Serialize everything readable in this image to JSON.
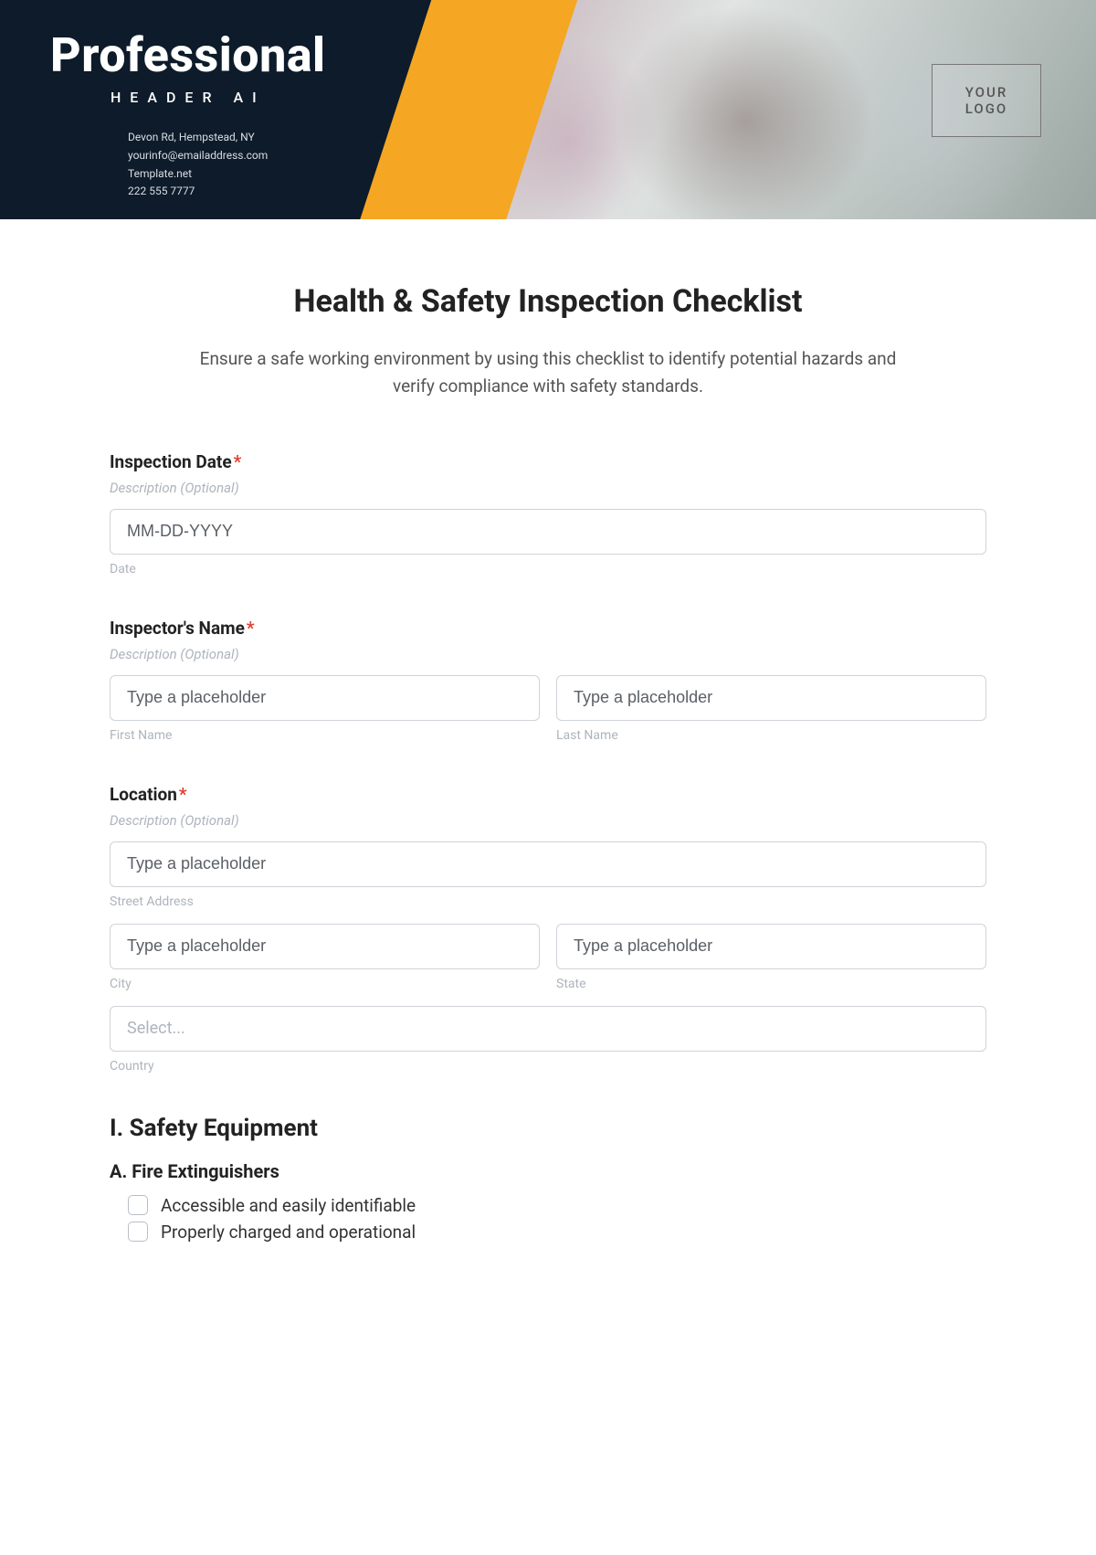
{
  "header": {
    "brand": "Professional",
    "tagline": "HEADER AI",
    "contact_lines": [
      "Devon Rd, Hempstead, NY",
      "yourinfo@emailaddress.com",
      "Template.net",
      "222 555 7777"
    ],
    "logo_text": "YOUR\nLOGO"
  },
  "title": "Health & Safety Inspection Checklist",
  "subtitle": "Ensure a safe working environment by using this checklist to identify potential hazards and verify compliance with safety standards.",
  "fields": {
    "date": {
      "label": "Inspection Date",
      "desc": "Description (Optional)",
      "placeholder": "MM-DD-YYYY",
      "sub": "Date"
    },
    "name": {
      "label": "Inspector's Name",
      "desc": "Description (Optional)",
      "first_ph": "Type a placeholder",
      "first_sub": "First Name",
      "last_ph": "Type a placeholder",
      "last_sub": "Last Name"
    },
    "loc": {
      "label": "Location",
      "desc": "Description (Optional)",
      "street_ph": "Type a placeholder",
      "street_sub": "Street Address",
      "city_ph": "Type a placeholder",
      "city_sub": "City",
      "state_ph": "Type a placeholder",
      "state_sub": "State",
      "country_ph": "Select...",
      "country_sub": "Country"
    }
  },
  "section1": {
    "heading": "I. Safety Equipment",
    "sub_a": "A. Fire Extinguishers",
    "items": [
      "Accessible and easily identifiable",
      "Properly charged and operational"
    ]
  }
}
